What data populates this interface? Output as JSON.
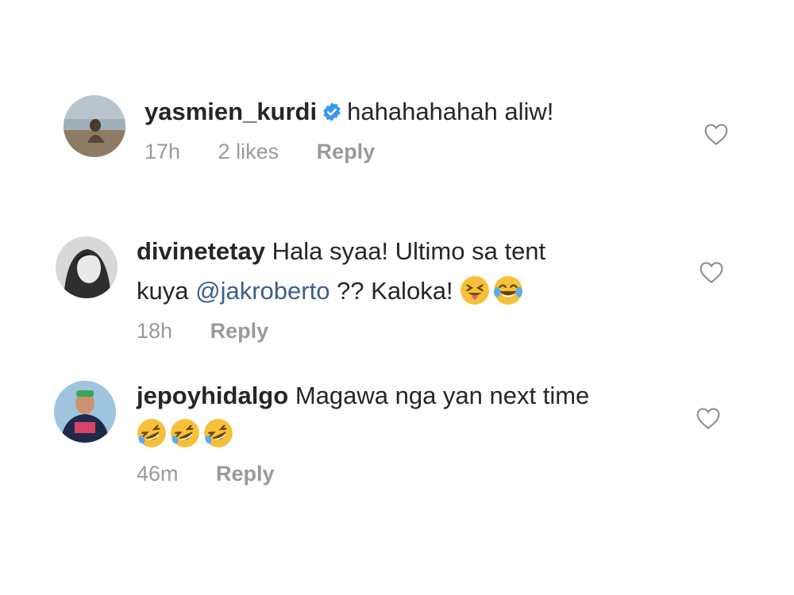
{
  "comments": [
    {
      "username": "yasmien_kurdi",
      "verified": true,
      "text_line1": "hahahahahah aliw!",
      "time": "17h",
      "likes": "2 likes",
      "reply_label": "Reply",
      "avatar_icon": "avatar-photo-beach"
    },
    {
      "username": "divinetetay",
      "text_line1": "Hala syaa! Ultimo sa tent",
      "text_line2_prefix": "kuya ",
      "mention": "@jakroberto",
      "text_line2_suffix": " ?? Kaloka! ",
      "emojis": [
        "squinting-face-with-tongue",
        "face-with-tears-of-joy"
      ],
      "time": "18h",
      "reply_label": "Reply",
      "avatar_icon": "avatar-photo-bw-portrait"
    },
    {
      "username": "jepoyhidalgo",
      "text_line1": "Magawa nga yan next time",
      "emojis": [
        "rolling-on-floor-laughing",
        "rolling-on-floor-laughing",
        "rolling-on-floor-laughing"
      ],
      "time": "46m",
      "reply_label": "Reply",
      "avatar_icon": "avatar-photo-jersey"
    }
  ],
  "colors": {
    "text": "#262626",
    "meta": "#9a9a9a",
    "mention": "#3d5f8a",
    "verified": "#3897f0",
    "heart_outline": "#8e8e8e"
  }
}
